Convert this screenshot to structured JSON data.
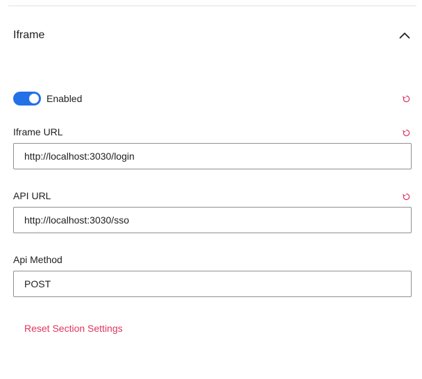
{
  "section": {
    "title": "Iframe",
    "expanded": true
  },
  "toggle": {
    "label": "Enabled",
    "checked": true,
    "color": "#2271e6"
  },
  "fields": [
    {
      "label": "Iframe URL",
      "value": "http://localhost:3030/login",
      "resettable": true
    },
    {
      "label": "API URL",
      "value": "http://localhost:3030/sso",
      "resettable": true
    },
    {
      "label": "Api Method",
      "value": "POST",
      "resettable": false
    }
  ],
  "reset_link": {
    "label": "Reset Section Settings",
    "color": "#e0345e"
  },
  "icons": {
    "collapse": "chevron-up-icon",
    "reset": "reset-icon"
  }
}
